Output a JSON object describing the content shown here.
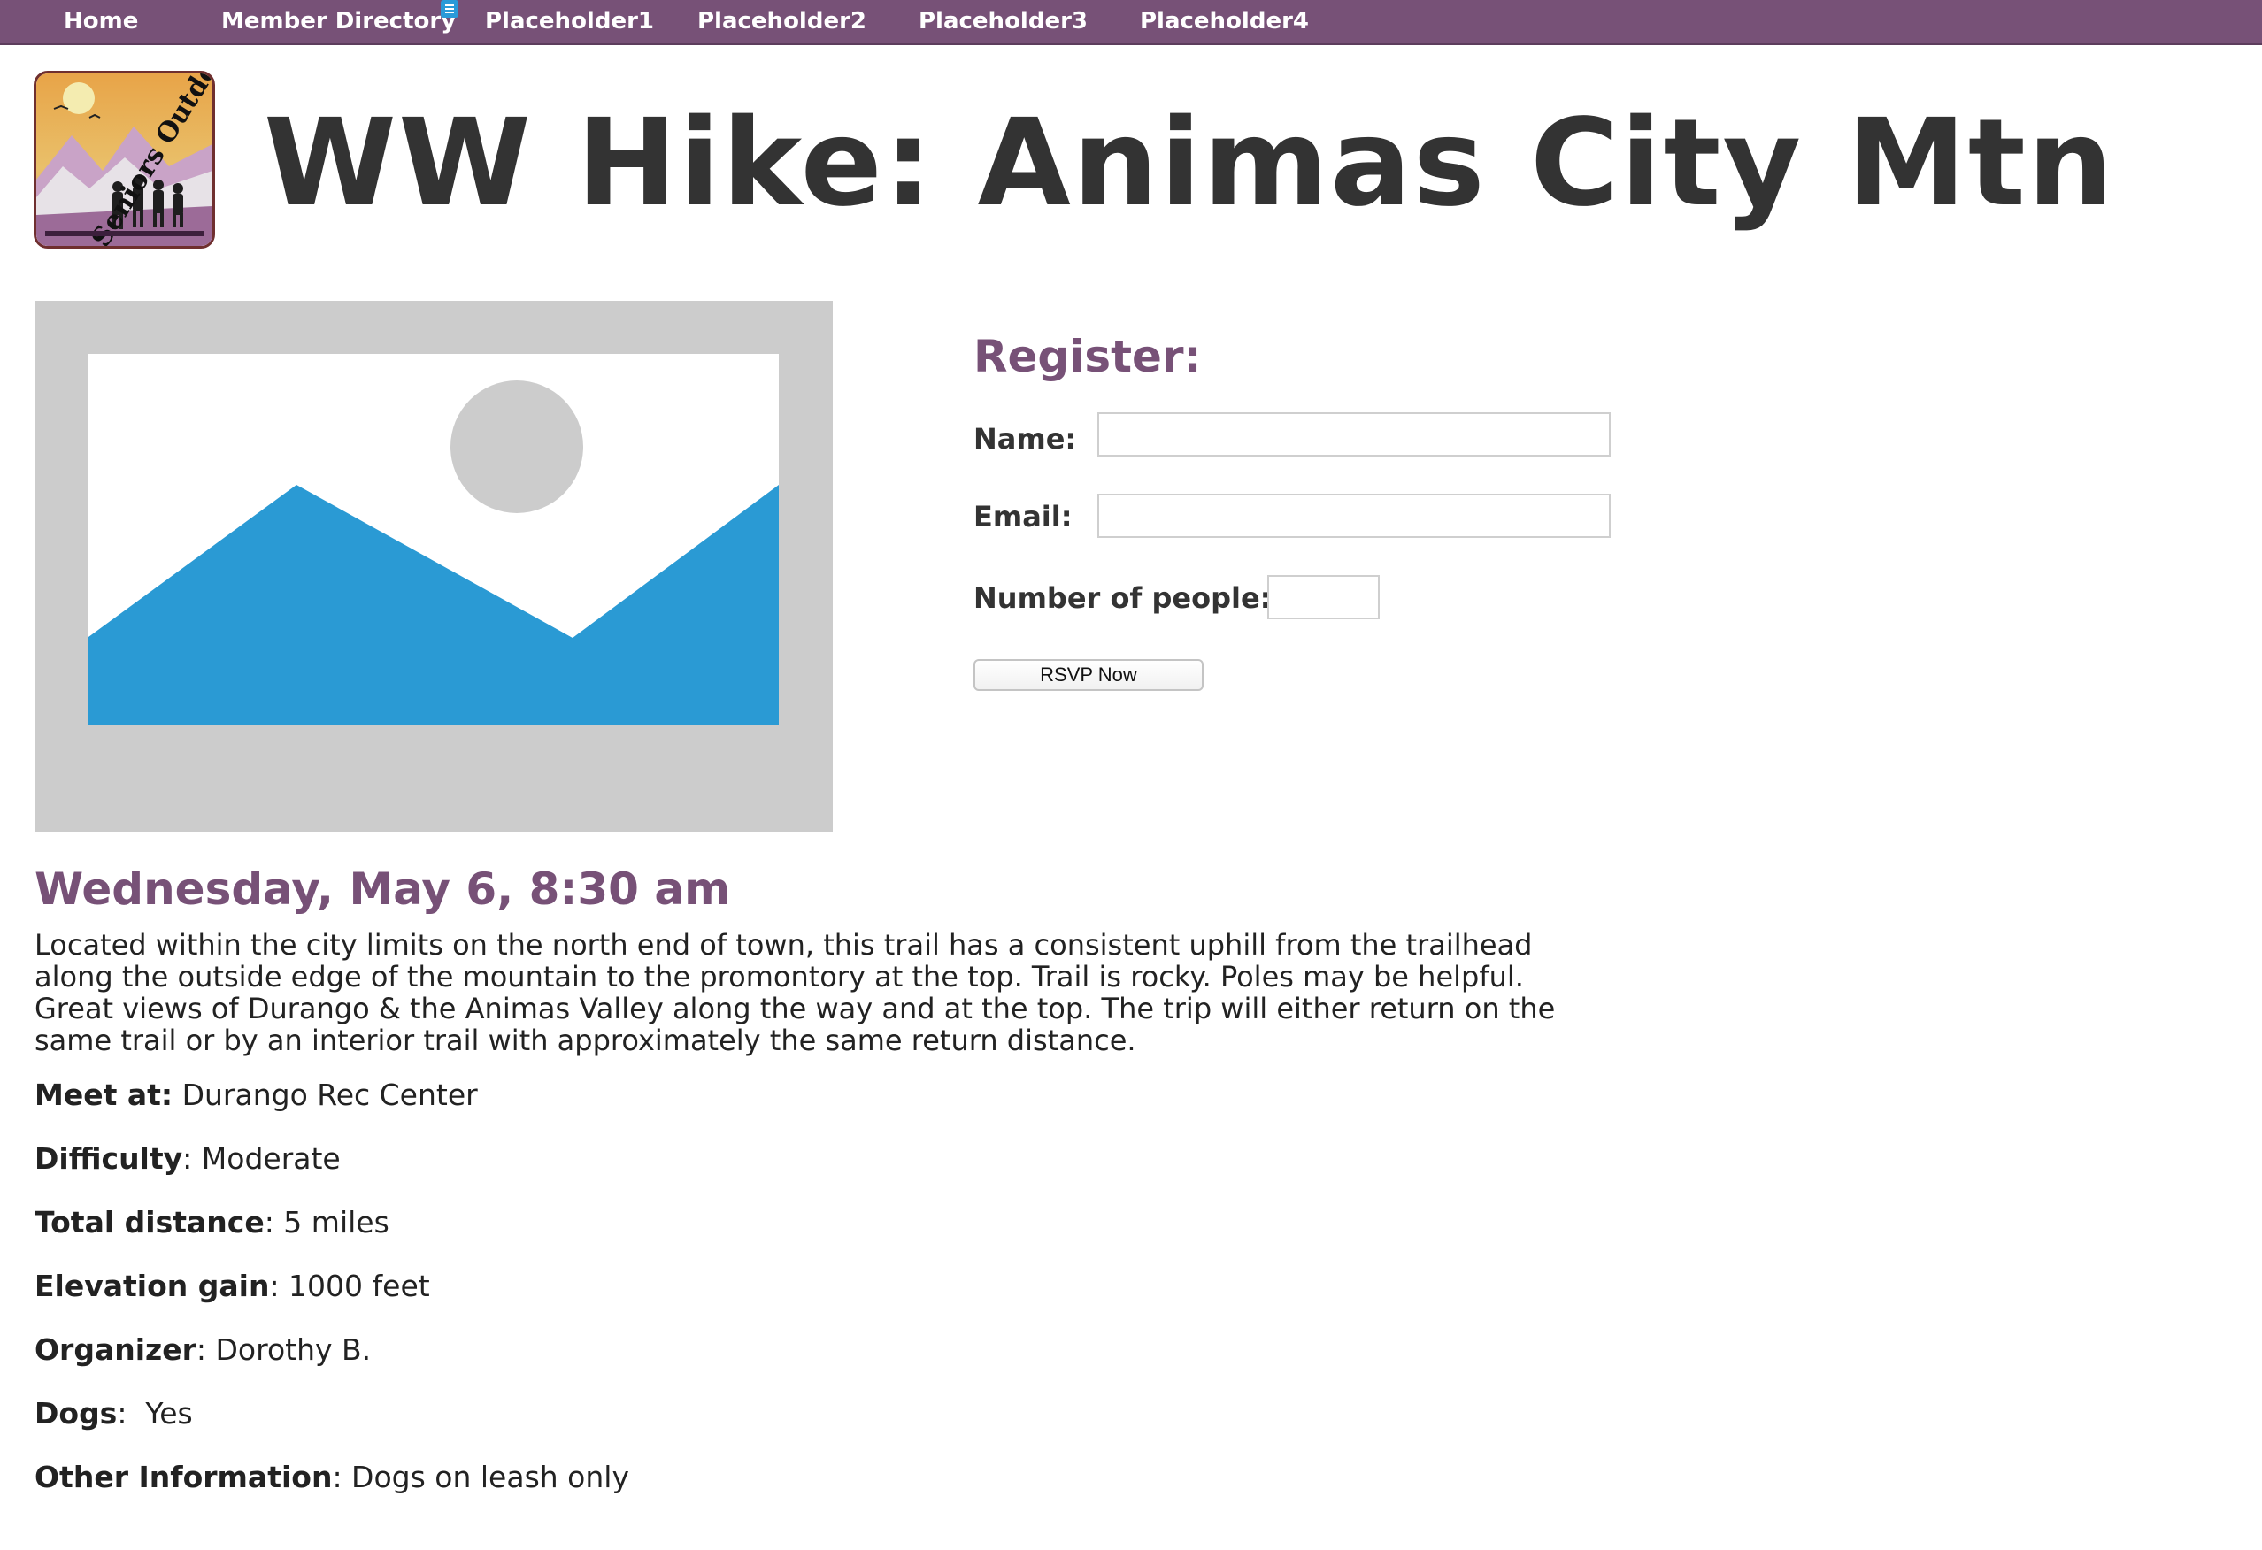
{
  "nav": {
    "items": [
      {
        "label": "Home"
      },
      {
        "label": "Member Directory"
      },
      {
        "label": "Placeholder1"
      },
      {
        "label": "Placeholder2"
      },
      {
        "label": "Placeholder3"
      },
      {
        "label": "Placeholder4"
      }
    ],
    "badge_icon": "menu-list-icon"
  },
  "logo": {
    "text": "Seniors Outdoors!",
    "icon": "hikers-logo-icon"
  },
  "page": {
    "title": "WW Hike: Animas City Mtn"
  },
  "hero_image": {
    "icon": "image-placeholder-icon"
  },
  "register": {
    "heading": "Register:",
    "name_label": "Name:",
    "name_value": "",
    "email_label": "Email:",
    "email_value": "",
    "people_label": "Number of people:",
    "people_value": "",
    "button_label": "RSVP Now"
  },
  "event": {
    "date_heading": "Wednesday, May 6, 8:30 am",
    "description": "Located within the city limits on the north end of town, this trail has a consistent uphill from the trailhead along the outside edge of the mountain to the promontory at the top. Trail is rocky. Poles may be helpful. Great views of Durango & the Animas Valley along the way and at the top.   The trip will either return on the same trail or by an interior trail with approximately the same return distance.",
    "details": [
      {
        "label": "Meet at:",
        "value": " Durango Rec Center"
      },
      {
        "label": "Difficulty",
        "value": ": Moderate"
      },
      {
        "label": "Total distance",
        "value": ": 5 miles"
      },
      {
        "label": "Elevation gain",
        "value": ": 1000 feet"
      },
      {
        "label": "Organizer",
        "value": ": Dorothy B."
      },
      {
        "label": "Dogs",
        "value": ":  Yes"
      },
      {
        "label": "Other Information",
        "value": ": Dogs on leash only"
      }
    ]
  },
  "colors": {
    "brand_purple": "#775177",
    "image_blue": "#2a9ad4",
    "image_gray": "#cccccc",
    "text_dark": "#333333"
  }
}
